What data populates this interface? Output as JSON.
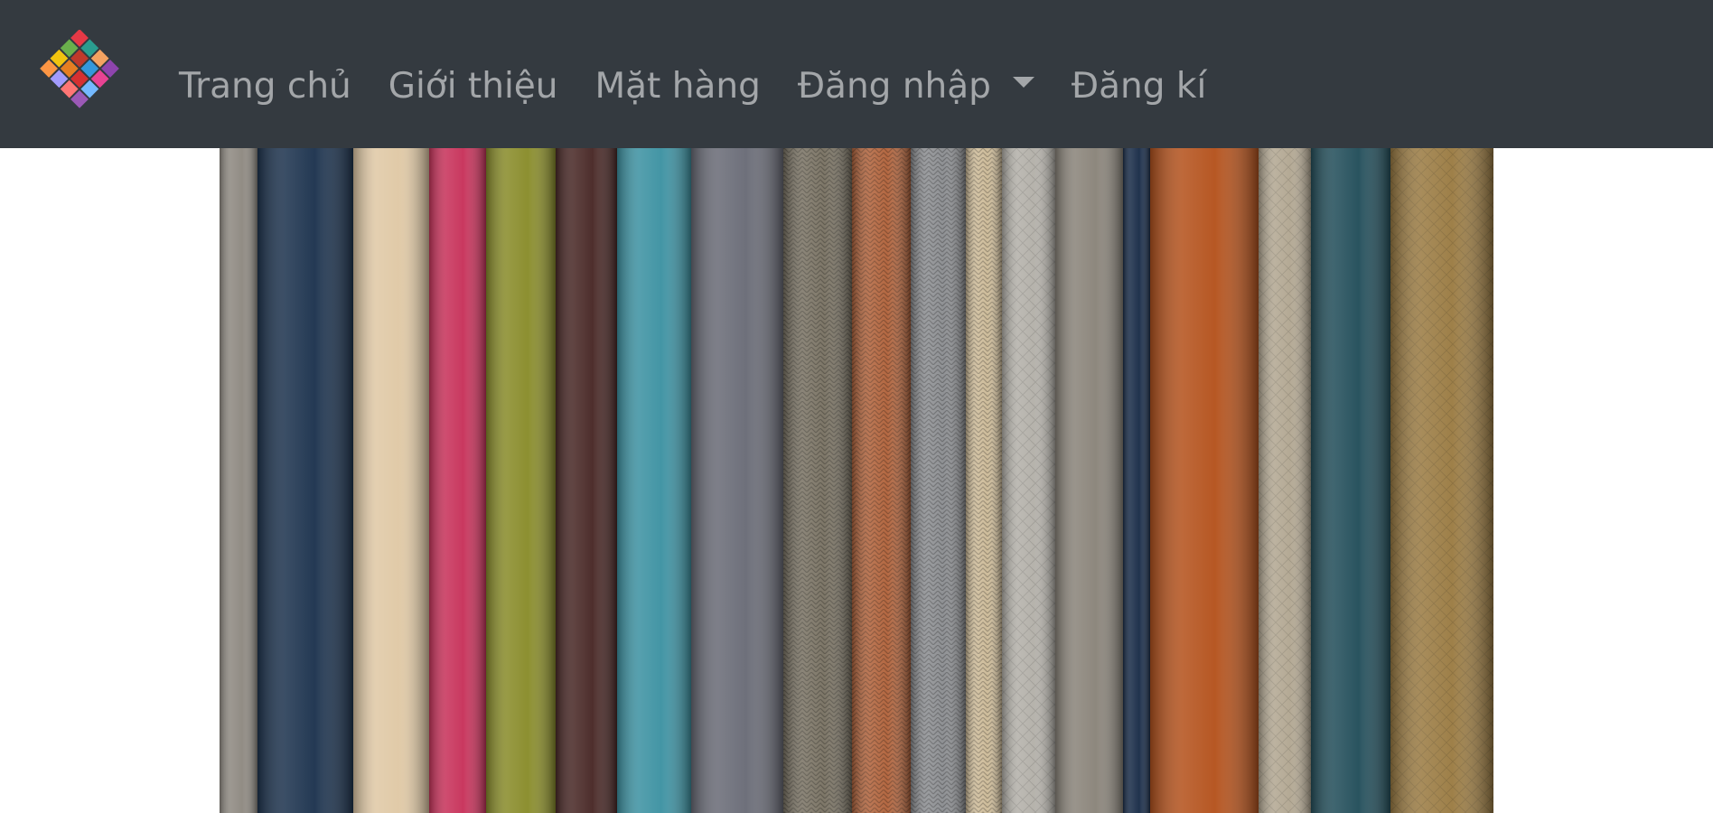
{
  "navbar": {
    "brand_icon": "woven-fabric-logo",
    "items": [
      {
        "label": "Trang chủ"
      },
      {
        "label": "Giới thiệu"
      },
      {
        "label": "Mặt hàng"
      },
      {
        "label": "Đăng nhập",
        "dropdown": true
      },
      {
        "label": "Đăng kí"
      }
    ],
    "background_color": "#343a40"
  },
  "hero": {
    "content": "fabric-rolls-photo",
    "fabric_colors": [
      "#8f8a82",
      "#1f3550",
      "#e0c9a6",
      "#c8345c",
      "#8a8d2c",
      "#4a2a28",
      "#3f93a3",
      "#6b6d78",
      "#7b7465",
      "#b2653e",
      "#8d8f92",
      "#cdbb99",
      "#b4b1aa",
      "#8b857b",
      "#1b2e4a",
      "#b5541f",
      "#b3a893",
      "#25505c",
      "#9c7d45"
    ]
  }
}
